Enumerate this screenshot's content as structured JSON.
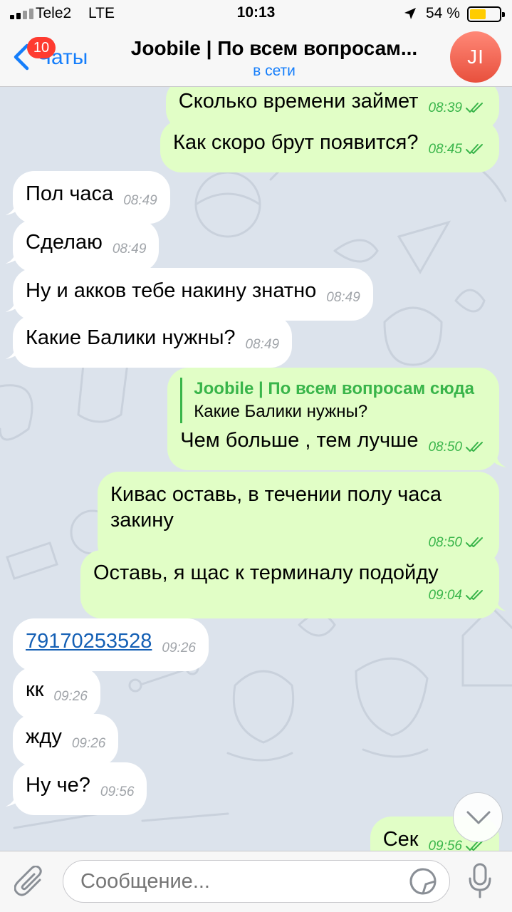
{
  "status_bar": {
    "carrier": "Tele2",
    "network": "LTE",
    "time": "10:13",
    "battery_percent": "54 %",
    "battery_level": 0.54,
    "battery_color": "#ffcc00"
  },
  "header": {
    "back_label": "Чаты",
    "unread_badge": "10",
    "title": "Joobile | По всем вопросам...",
    "subtitle": "в сети",
    "avatar_initials": "JI",
    "accent_color": "#157efb"
  },
  "messages": [
    {
      "direction": "out",
      "text": "Сколько времени займет",
      "time": "08:39",
      "read": true
    },
    {
      "direction": "out",
      "text": "Как скоро брут появится?",
      "time": "08:45",
      "read": true
    },
    {
      "direction": "in",
      "text": "Пол часа",
      "time": "08:49"
    },
    {
      "direction": "in",
      "text": "Сделаю",
      "time": "08:49"
    },
    {
      "direction": "in",
      "text": "Ну и акков тебе накину знатно",
      "time": "08:49"
    },
    {
      "direction": "in",
      "text": "Какие Балики нужны?",
      "time": "08:49"
    },
    {
      "direction": "out",
      "reply_author": "Joobile | По всем вопросам сюда",
      "reply_text": "Какие Балики нужны?",
      "text": "Чем больше , тем лучше",
      "time": "08:50",
      "read": true
    },
    {
      "direction": "out",
      "text": "Кивас оставь, в течении полу часа закину",
      "time": "08:50",
      "read": true
    },
    {
      "direction": "out",
      "text": "Оставь, я щас к терминалу подойду",
      "time": "09:04",
      "read": true
    },
    {
      "direction": "in",
      "text": "79170253528",
      "time": "09:26",
      "is_link": true
    },
    {
      "direction": "in",
      "text": "кк",
      "time": "09:26"
    },
    {
      "direction": "in",
      "text": "жду",
      "time": "09:26"
    },
    {
      "direction": "in",
      "text": "Ну че?",
      "time": "09:56"
    },
    {
      "direction": "out",
      "text": "Сек",
      "time": "09:56",
      "read": true
    }
  ],
  "input": {
    "placeholder": "Сообщение..."
  },
  "colors": {
    "incoming_bubble": "#ffffff",
    "outgoing_bubble": "#e1fec6",
    "outgoing_meta": "#39b54a",
    "link": "#1560b5"
  },
  "icons": {
    "back": "chevron-left-icon",
    "attach": "paperclip-icon",
    "sticker": "sticker-icon",
    "mic": "microphone-icon",
    "scroll_down": "chevron-down-icon",
    "read_receipt": "double-check-icon"
  }
}
